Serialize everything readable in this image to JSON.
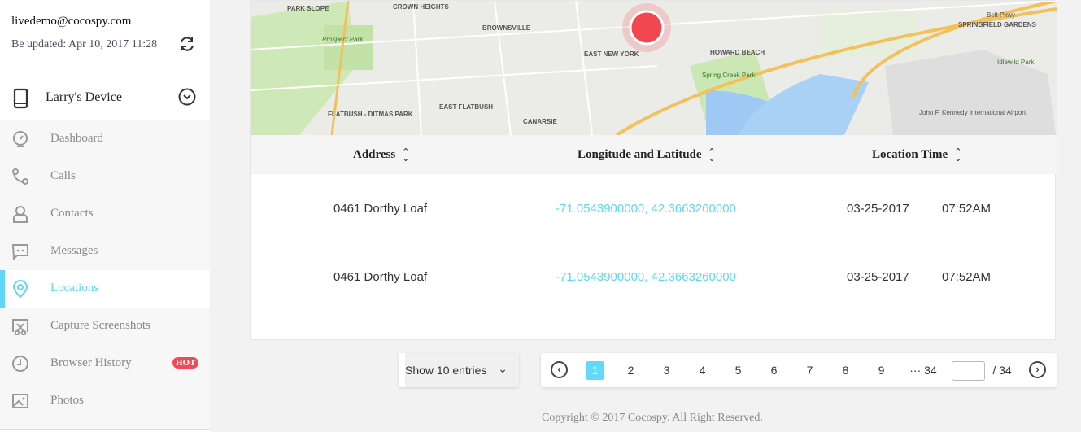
{
  "account": {
    "email": "livedemo@cocospy.com",
    "updated": "Be updated: Apr 10, 2017 11:28"
  },
  "device": {
    "name": "Larry's Device"
  },
  "menu": [
    {
      "label": "Dashboard",
      "icon": "dashboard-icon"
    },
    {
      "label": "Calls",
      "icon": "phone-icon"
    },
    {
      "label": "Contacts",
      "icon": "person-icon"
    },
    {
      "label": "Messages",
      "icon": "message-icon"
    },
    {
      "label": "Locations",
      "icon": "location-pin-icon",
      "active": true
    },
    {
      "label": "Capture Screenshots",
      "icon": "screenshot-icon"
    },
    {
      "label": "Browser History",
      "icon": "clock-icon",
      "badge": "HOT"
    },
    {
      "label": "Photos",
      "icon": "image-icon"
    }
  ],
  "map": {
    "labels": [
      "PARK SLOPE",
      "CROWN HEIGHTS",
      "Prospect Park",
      "BROWNSVILLE",
      "EAST NEW YORK",
      "HOWARD BEACH",
      "SPRINGFIELD GARDENS",
      "Idlewild Park",
      "Spring Creek Park",
      "FLATBUSH - DITMAS PARK",
      "EAST FLATBUSH",
      "CANARSIE",
      "John F. Kennedy International Airport",
      "Belt Pkwy"
    ],
    "marker_color": "#f2474f"
  },
  "table": {
    "headers": [
      "Address",
      "Longitude and Latitude",
      "Location Time"
    ],
    "rows": [
      {
        "address": "0461 Dorthy Loaf",
        "coords": "-71.0543900000, 42.3663260000",
        "date": "03-25-2017",
        "time": "07:52AM"
      },
      {
        "address": "0461 Dorthy Loaf",
        "coords": "-71.0543900000, 42.3663260000",
        "date": "03-25-2017",
        "time": "07:52AM"
      }
    ]
  },
  "pagination": {
    "entries": "Show 10 entries",
    "pages": [
      "1",
      "2",
      "3",
      "4",
      "5",
      "6",
      "7",
      "8",
      "9"
    ],
    "ellipsis_last": "··· 34",
    "total": "/ 34",
    "current": 1
  },
  "footer": "Copyright © 2017 Cocospy. All Right Reserved.",
  "colors": {
    "accent": "#5dd6f7",
    "hot": "#f24a55"
  }
}
